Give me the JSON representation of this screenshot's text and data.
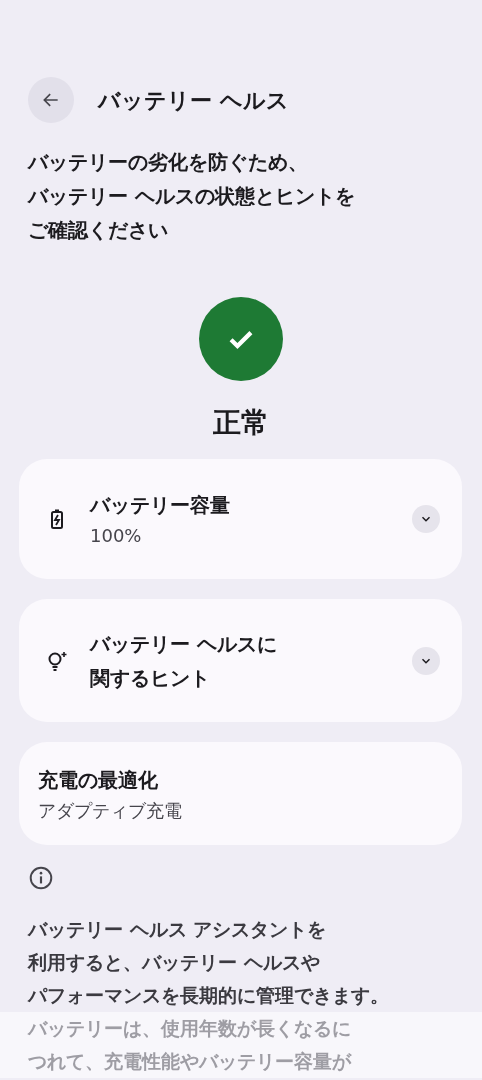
{
  "header": {
    "title": "バッテリー ヘルス"
  },
  "description": [
    "バッテリーの劣化を防ぐため、",
    "バッテリー ヘルスの状態とヒントを",
    "ご確認ください"
  ],
  "status": {
    "kind": "ok",
    "label": "正常"
  },
  "cards": [
    {
      "kind": "capacity",
      "title": [
        "バッテリー容量"
      ],
      "subtitle": "100%",
      "expanded": false
    },
    {
      "kind": "tips",
      "title": [
        "バッテリー ヘルスに",
        "関するヒント"
      ],
      "expanded": false
    },
    {
      "kind": "setting",
      "title": [
        "充電の最適化"
      ],
      "subtitle": "アダプティブ充電"
    }
  ],
  "info": {
    "lines": [
      {
        "text": "バッテリー ヘルス アシスタントを",
        "dimmed": false
      },
      {
        "text": "利用すると、バッテリー ヘルスや",
        "dimmed": false
      },
      {
        "text": "パフォーマンスを長期的に管理できます。",
        "dimmed": false
      },
      {
        "text": "バッテリーは、使用年数が長くなるに",
        "dimmed": true
      },
      {
        "text": "つれて、充電性能やバッテリー容量が",
        "dimmed": true
      }
    ]
  }
}
